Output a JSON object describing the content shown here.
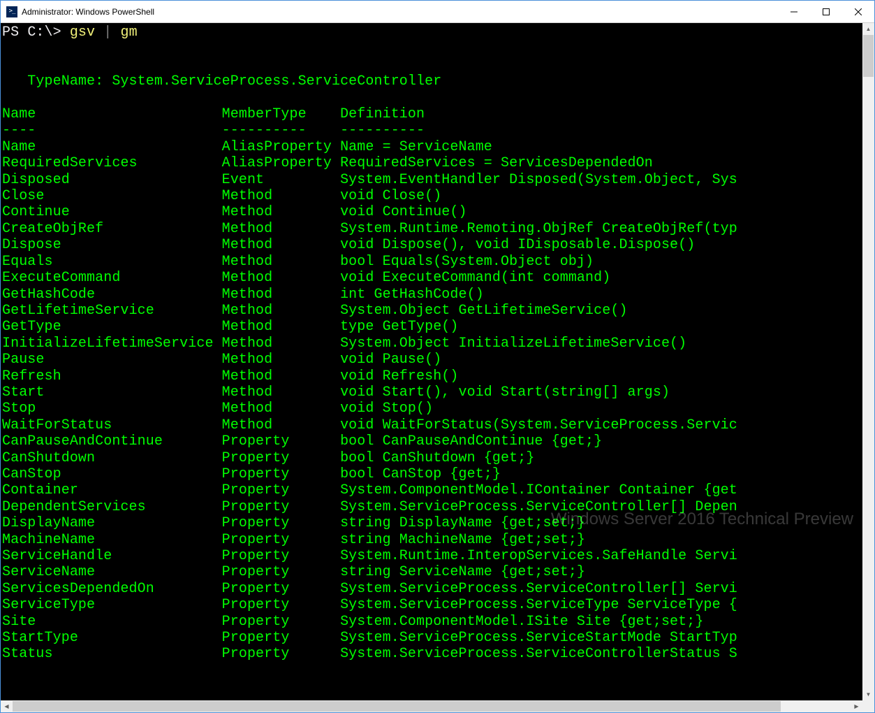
{
  "window": {
    "title": "Administrator: Windows PowerShell"
  },
  "prompt": {
    "ps": "PS ",
    "path": "C:\\> ",
    "cmd1": "gsv ",
    "pipe": "| ",
    "cmd2": "gm"
  },
  "typename_label": "   TypeName: ",
  "typename_value": "System.ServiceProcess.ServiceController",
  "headers": {
    "name": "Name",
    "membertype": "MemberType",
    "definition": "Definition"
  },
  "dividers": {
    "name": "----",
    "membertype": "----------",
    "definition": "----------"
  },
  "col_widths": {
    "name": 26,
    "membertype": 14
  },
  "rows": [
    {
      "n": "Name",
      "m": "AliasProperty",
      "d": "Name = ServiceName"
    },
    {
      "n": "RequiredServices",
      "m": "AliasProperty",
      "d": "RequiredServices = ServicesDependedOn"
    },
    {
      "n": "Disposed",
      "m": "Event",
      "d": "System.EventHandler Disposed(System.Object, Sys"
    },
    {
      "n": "Close",
      "m": "Method",
      "d": "void Close()"
    },
    {
      "n": "Continue",
      "m": "Method",
      "d": "void Continue()"
    },
    {
      "n": "CreateObjRef",
      "m": "Method",
      "d": "System.Runtime.Remoting.ObjRef CreateObjRef(typ"
    },
    {
      "n": "Dispose",
      "m": "Method",
      "d": "void Dispose(), void IDisposable.Dispose()"
    },
    {
      "n": "Equals",
      "m": "Method",
      "d": "bool Equals(System.Object obj)"
    },
    {
      "n": "ExecuteCommand",
      "m": "Method",
      "d": "void ExecuteCommand(int command)"
    },
    {
      "n": "GetHashCode",
      "m": "Method",
      "d": "int GetHashCode()"
    },
    {
      "n": "GetLifetimeService",
      "m": "Method",
      "d": "System.Object GetLifetimeService()"
    },
    {
      "n": "GetType",
      "m": "Method",
      "d": "type GetType()"
    },
    {
      "n": "InitializeLifetimeService",
      "m": "Method",
      "d": "System.Object InitializeLifetimeService()"
    },
    {
      "n": "Pause",
      "m": "Method",
      "d": "void Pause()"
    },
    {
      "n": "Refresh",
      "m": "Method",
      "d": "void Refresh()"
    },
    {
      "n": "Start",
      "m": "Method",
      "d": "void Start(), void Start(string[] args)"
    },
    {
      "n": "Stop",
      "m": "Method",
      "d": "void Stop()"
    },
    {
      "n": "WaitForStatus",
      "m": "Method",
      "d": "void WaitForStatus(System.ServiceProcess.Servic"
    },
    {
      "n": "CanPauseAndContinue",
      "m": "Property",
      "d": "bool CanPauseAndContinue {get;}"
    },
    {
      "n": "CanShutdown",
      "m": "Property",
      "d": "bool CanShutdown {get;}"
    },
    {
      "n": "CanStop",
      "m": "Property",
      "d": "bool CanStop {get;}"
    },
    {
      "n": "Container",
      "m": "Property",
      "d": "System.ComponentModel.IContainer Container {get"
    },
    {
      "n": "DependentServices",
      "m": "Property",
      "d": "System.ServiceProcess.ServiceController[] Depen"
    },
    {
      "n": "DisplayName",
      "m": "Property",
      "d": "string DisplayName {get;set;}"
    },
    {
      "n": "MachineName",
      "m": "Property",
      "d": "string MachineName {get;set;}"
    },
    {
      "n": "ServiceHandle",
      "m": "Property",
      "d": "System.Runtime.InteropServices.SafeHandle Servi"
    },
    {
      "n": "ServiceName",
      "m": "Property",
      "d": "string ServiceName {get;set;}"
    },
    {
      "n": "ServicesDependedOn",
      "m": "Property",
      "d": "System.ServiceProcess.ServiceController[] Servi"
    },
    {
      "n": "ServiceType",
      "m": "Property",
      "d": "System.ServiceProcess.ServiceType ServiceType {"
    },
    {
      "n": "Site",
      "m": "Property",
      "d": "System.ComponentModel.ISite Site {get;set;}"
    },
    {
      "n": "StartType",
      "m": "Property",
      "d": "System.ServiceProcess.ServiceStartMode StartTyp"
    },
    {
      "n": "Status",
      "m": "Property",
      "d": "System.ServiceProcess.ServiceControllerStatus S"
    }
  ],
  "watermark": "Windows Server 2016 Technical Preview"
}
